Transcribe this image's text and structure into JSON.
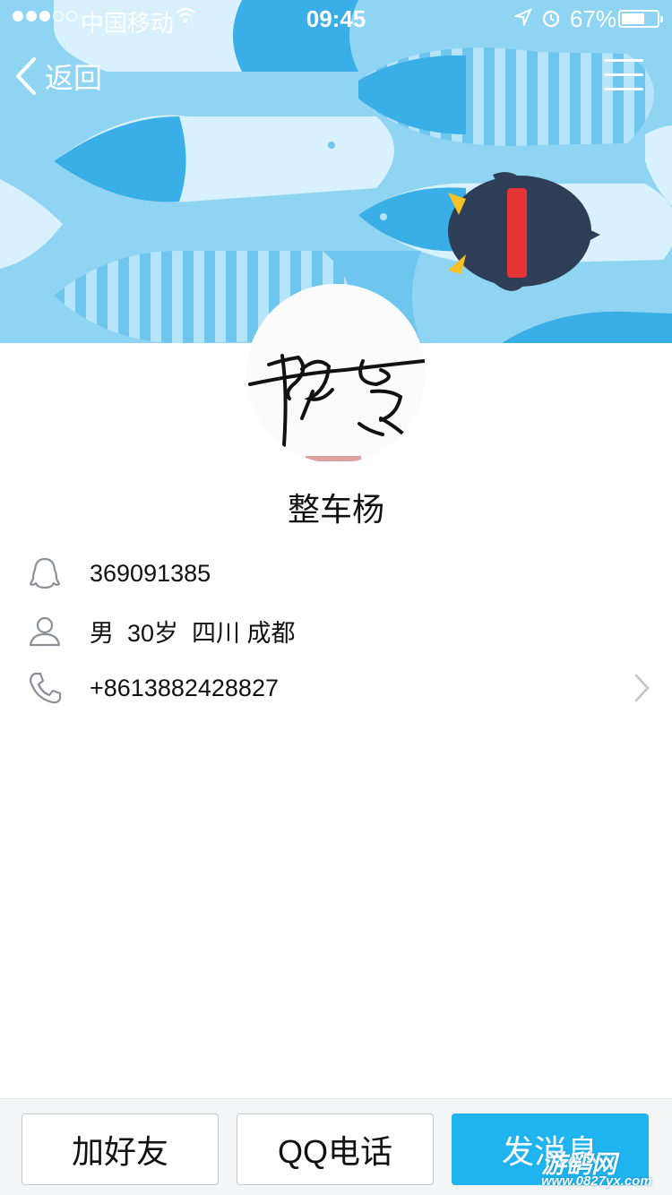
{
  "status_bar": {
    "carrier": "中国移动",
    "time": "09:45",
    "battery_percent": "67%",
    "battery_level": 0.67
  },
  "nav": {
    "back_label": "返回",
    "back_icon": "chevron-left-icon",
    "menu_icon": "hamburger-menu-icon"
  },
  "profile": {
    "nickname": "整车杨",
    "avatar": "signature-avatar"
  },
  "info": {
    "qq_number": "369091385",
    "details": "男  30岁  四川 成都",
    "phone": "+8613882428827"
  },
  "actions": {
    "add_friend": "加好友",
    "qq_call": "QQ电话",
    "send_message": "发消息"
  },
  "watermark": {
    "text": "游鹞网",
    "url": "www.0827yx.com"
  },
  "colors": {
    "banner_bg": "#8fd5f3",
    "primary_button": "#1fb4f0",
    "icon_gray": "#8a8f99"
  }
}
